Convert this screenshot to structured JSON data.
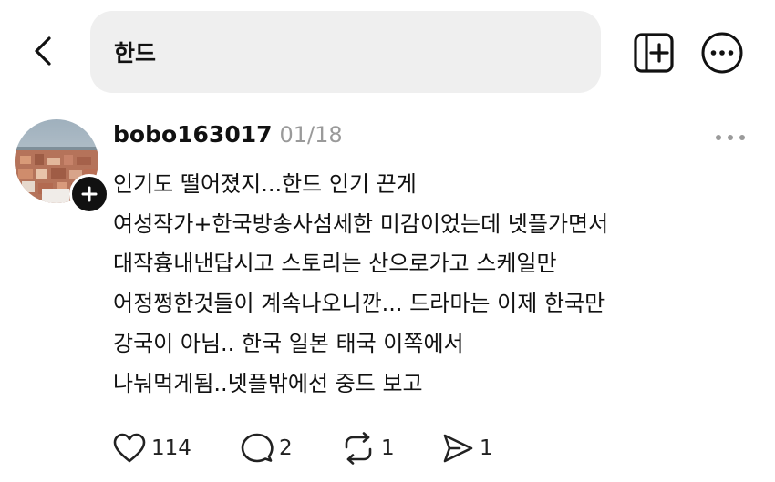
{
  "header": {
    "back_icon": "chevron-left-icon",
    "search_query": "한드",
    "new_post_icon": "new-post-icon",
    "more_icon": "more-circle-icon"
  },
  "post": {
    "username": "bobo163017",
    "timestamp": "01/18",
    "lines": [
      "인기도 떨어졌지...한드 인기 끈게",
      "여성작가+한국방송사섬세한 미감이었는데 넷플가면서",
      "대작흉내낸답시고 스토리는 산으로가고 스케일만",
      "어정쩡한것들이 계속나오니깐... 드라마는 이제 한국만",
      "강국이 아님.. 한국 일본 태국 이쪽에서",
      "나눠먹게됨..넷플밖에선 중드 보고"
    ],
    "actions": {
      "likes": "114",
      "replies": "2",
      "reposts": "1",
      "shares": "1"
    }
  }
}
